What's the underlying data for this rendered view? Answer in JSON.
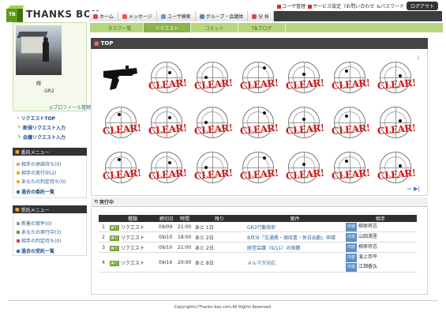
{
  "brand": {
    "logo_badge": "TB",
    "name": "THANKS BOX"
  },
  "top_links": {
    "user_manage": "ユーザ管理",
    "service_settings": "サービス設定",
    "contact": "?お問い合わせ",
    "password": "&パスワード",
    "logout": "ログアウト"
  },
  "nav": {
    "home": "ホーム",
    "message": "メッセージ",
    "user_search": "ユーザ検索",
    "group": "グループ・会議体",
    "analysis": "分 析"
  },
  "subnav": {
    "task": "タスク一覧",
    "request": "リクエスト",
    "commit": "コミット",
    "tb_blog": "TBブログ"
  },
  "profile": {
    "name": "輝",
    "id": "GR2",
    "manage_link": "◎プロフィール管理"
  },
  "side_links": {
    "request_top": "リクエストTOP",
    "new_request": "新規リクエスト入力",
    "meeting_request": "会議リクエスト入力"
  },
  "order_menu": {
    "title": "委託メニュー",
    "item1": "相手の承諾待ち(0)",
    "item2": "相手の実行中(2)",
    "item3": "あなたの判定待ち(0)",
    "item4": "過去の委託一覧"
  },
  "recv_menu": {
    "title": "受託メニュー",
    "item1": "新着の案件(0)",
    "item2": "あなたの実行中(3)",
    "item3": "相手の判定待ち(0)",
    "item4": "過去の受託一覧"
  },
  "top_panel": {
    "title": "TOP",
    "page": "1",
    "stamp_text": "CLEAR!",
    "nav_arrows": "⇨ ▶|"
  },
  "running": {
    "title": "実行中",
    "headers": [
      "種類",
      "締切日",
      "時間",
      "残り",
      "案件",
      "相手"
    ],
    "badge": "実行",
    "recv_tag": "内容",
    "rows": [
      {
        "no": "1",
        "type": "リクエスト",
        "date": "09/09",
        "time": "21:00",
        "left": "あと 1日",
        "case": "GR2行動指針",
        "partners": [
          "柳原将志"
        ]
      },
      {
        "no": "2",
        "type": "リクエスト",
        "date": "09/10",
        "time": "18:00",
        "left": "あと 2日",
        "case": "8月分「交通費・領収書・休日出勤」申請",
        "partners": [
          "山田満里"
        ]
      },
      {
        "no": "3",
        "type": "リクエスト",
        "date": "09/10",
        "time": "21:00",
        "left": "あと 2日",
        "case": "経営会議（9/11）の宿題",
        "partners": [
          "柳原将志"
        ]
      },
      {
        "no": "4",
        "type": "リクエスト",
        "date": "09/16",
        "time": "20:00",
        "left": "あと 8日",
        "case": "メルマガ対応",
        "partners": [
          "滝上恭平",
          "江畑香弘"
        ]
      }
    ]
  },
  "footer": "Copyright(c)Thanks-box.com,All Rights Reserved.",
  "colors": {
    "accent_green": "#8bb449",
    "dark_bar": "#333333",
    "clear_red": "#cc1a1a",
    "link_blue": "#2c5f98"
  }
}
